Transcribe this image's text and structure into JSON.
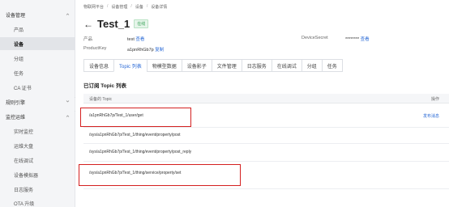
{
  "sidebar": {
    "groups": [
      {
        "label": "设备管理",
        "items": [
          "产品",
          "设备",
          "分组",
          "任务",
          "CA 证书"
        ]
      },
      {
        "label": "规则引擎",
        "items": []
      },
      {
        "label": "监控运维",
        "items": [
          "实时监控",
          "运维大盘",
          "在线调试",
          "设备模拟器",
          "日志服务",
          "OTA 升级"
        ]
      }
    ],
    "active_item": "设备"
  },
  "breadcrumb": [
    "物联网平台",
    "设备管理",
    "设备",
    "设备详情"
  ],
  "device": {
    "name": "Test_1",
    "status": "在线",
    "product_label": "产品",
    "product_value": "test",
    "product_link": "查看",
    "productkey_label": "ProductKey",
    "productkey_value": "a1pnRhGb7p",
    "productkey_link": "复制",
    "secret_label": "DeviceSecret",
    "secret_value": "********",
    "secret_link": "查看"
  },
  "tabs": [
    "设备信息",
    "Topic 列表",
    "物模型数据",
    "设备影子",
    "文件管理",
    "日志服务",
    "在线调试",
    "分组",
    "任务"
  ],
  "active_tab": "Topic 列表",
  "section_title": "已订阅 Topic 列表",
  "table": {
    "columns": [
      "设备的 Topic",
      "操作"
    ],
    "rows": [
      {
        "topic": "/a1pnRhGb7p/Test_1/user/get",
        "action": "发布消息"
      },
      {
        "topic": "/sys/a1pnRhGb7p/Test_1/thing/event/property/post",
        "action": ""
      },
      {
        "topic": "/sys/a1pnRhGb7p/Test_1/thing/event/property/post_reply",
        "action": ""
      },
      {
        "topic": "/sys/a1pnRhGb7p/Test_1/thing/service/property/set",
        "action": ""
      }
    ]
  },
  "colors": {
    "highlight": "#d42020",
    "link": "#2a6ad6",
    "status_green": "#2e9d4f"
  }
}
